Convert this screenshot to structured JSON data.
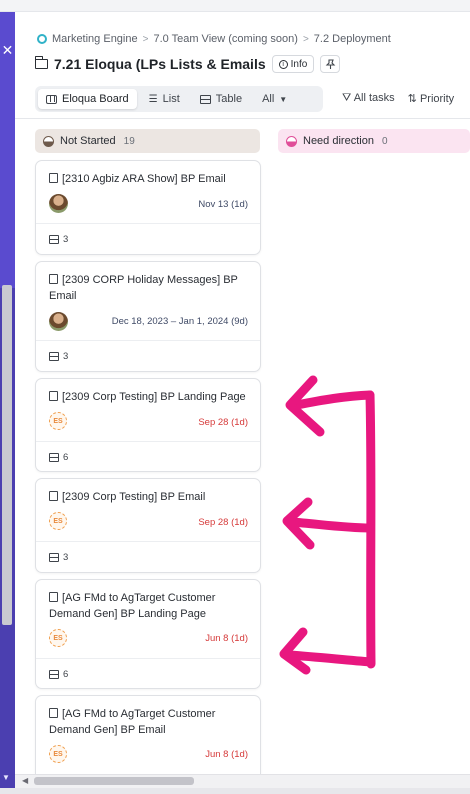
{
  "breadcrumb": {
    "items": [
      "Marketing Engine",
      "7.0 Team View (coming soon)",
      "7.2 Deployment"
    ],
    "separator": ">"
  },
  "header": {
    "title": "7.21 Eloqua (LPs  Lists  & Emails",
    "info_label": "Info"
  },
  "views": {
    "tabs": [
      {
        "label": "Eloqua Board",
        "icon": "board-icon",
        "active": true
      },
      {
        "label": "List",
        "icon": "list-icon",
        "active": false
      },
      {
        "label": "Table",
        "icon": "table-icon",
        "active": false
      },
      {
        "label": "All",
        "icon": "chevron-down-icon",
        "active": false
      }
    ]
  },
  "filters": {
    "all_tasks": "All tasks",
    "priority": "Priority"
  },
  "columns": [
    {
      "name": "Not Started",
      "count": "19",
      "color": "#6e5a4c"
    },
    {
      "name": "Need direction",
      "count": "0",
      "color": "#e04e99"
    }
  ],
  "cards": [
    {
      "title": "[2310 Agbiz ARA Show] BP Email",
      "assignee": "photo",
      "date": "Nov 13 (1d)",
      "overdue": false,
      "subtasks": "3"
    },
    {
      "title": "[2309 CORP Holiday Messages] BP Email",
      "assignee": "photo",
      "date": "Dec 18, 2023 – Jan 1, 2024 (9d)",
      "overdue": false,
      "subtasks": "3"
    },
    {
      "title": "[2309 Corp Testing] BP Landing Page",
      "assignee": "ES",
      "date": "Sep 28 (1d)",
      "overdue": true,
      "subtasks": "6"
    },
    {
      "title": "[2309 Corp Testing] BP Email",
      "assignee": "ES",
      "date": "Sep 28 (1d)",
      "overdue": true,
      "subtasks": "3"
    },
    {
      "title": "[AG FMd to AgTarget Customer Demand Gen] BP Landing Page",
      "assignee": "ES",
      "date": "Jun 8 (1d)",
      "overdue": true,
      "subtasks": "6"
    },
    {
      "title": "[AG FMd to AgTarget Customer Demand Gen] BP Email",
      "assignee": "ES",
      "date": "Jun 8 (1d)",
      "overdue": true
    }
  ],
  "colors": {
    "accent": "#5a4bcf",
    "overdue": "#d63a3a",
    "annotation": "#e8177f"
  }
}
